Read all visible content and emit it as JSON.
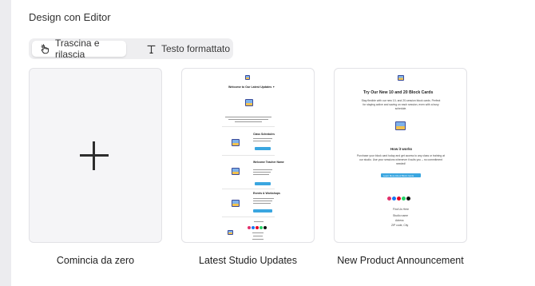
{
  "section": {
    "title": "Design con Editor"
  },
  "mode_toggle": {
    "drag_drop": {
      "label": "Trascina e rilascia",
      "icon": "hand-pointer-icon",
      "active": true
    },
    "rich_text": {
      "label": "Testo formattato",
      "icon": "text-format-icon",
      "active": false
    }
  },
  "templates": [
    {
      "label": "Comincia da zero",
      "icon": "plus-icon"
    },
    {
      "label": "Latest Studio Updates",
      "preview": {
        "heading": "Welcome to Our Latest Updates ✦",
        "sections": [
          "Class Schedules",
          "Welcome Teacher Name",
          "Events & Workshops"
        ]
      }
    },
    {
      "label": "New Product Announcement",
      "preview": {
        "heading": "Try Our New 10 and 20 Block Cards",
        "intro": "Stay flexible with our new 10- and 20-session block cards. Perfect for staying active and saving on each session, even with a busy schedule.",
        "how_title": "How it works",
        "how_text": "Purchase your block card today and get access to any class or training at our studio. Use your sessions whenever it suits you – no commitment needed!",
        "button": "Learn More About Block Cards",
        "signoff_1": "Find Us Here",
        "signoff_2": "Studio name",
        "signoff_3": "Adress",
        "signoff_4": "ZIP code, City"
      }
    }
  ],
  "colors": {
    "accent": "#3aa6e0",
    "card_border": "#e2e2e6",
    "blank_card_bg": "#f5f5f7"
  }
}
